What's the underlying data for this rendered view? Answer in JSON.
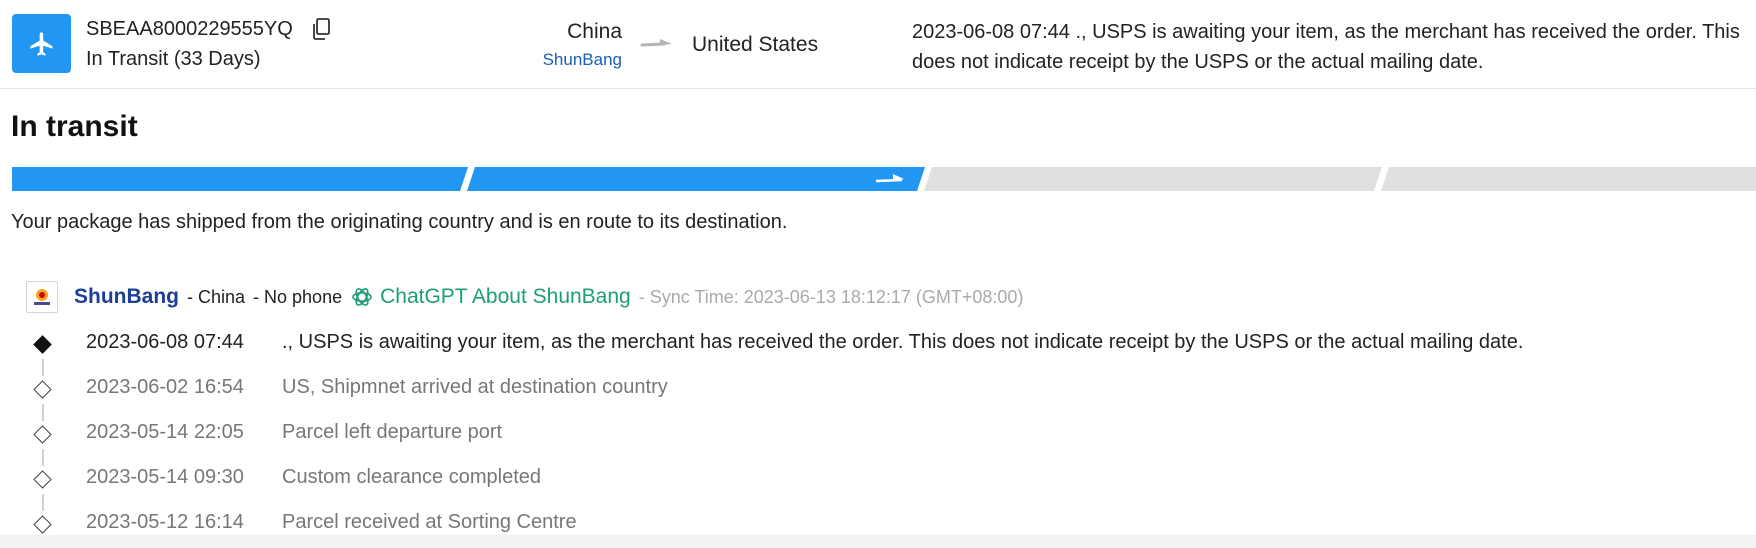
{
  "header": {
    "tracking_number": "SBEAA8000229555YQ",
    "status_days": "In Transit (33 Days)",
    "origin_country": "China",
    "carrier_link": "ShunBang",
    "destination_country": "United States",
    "latest_event": "2023-06-08 07:44  ., USPS is awaiting your item, as the merchant has received the order. This does not indicate receipt by the USPS or the actual mailing date.",
    "icons": {
      "status": "airplane-icon",
      "copy": "copy-icon",
      "route": "arrow-right-icon"
    }
  },
  "main": {
    "title": "In transit",
    "progress": {
      "steps_total": 4,
      "steps_completed": 2,
      "active_color": "#2196f3",
      "inactive_color": "#e0e0e0"
    },
    "description": "Your package has shipped from the originating country and is en route to its destination."
  },
  "carrier": {
    "name": "ShunBang",
    "country": "- China",
    "phone": "- No phone",
    "chatgpt_link": "ChatGPT About ShunBang",
    "sync_time": "- Sync Time: 2023-06-13 18:12:17 (GMT+08:00)",
    "icons": {
      "logo": "carrier-logo",
      "chatgpt": "openai-icon"
    }
  },
  "events": [
    {
      "time": "2023-06-08 07:44",
      "message": "., USPS is awaiting your item, as the merchant has received the order. This does not indicate receipt by the USPS or the actual mailing date."
    },
    {
      "time": "2023-06-02 16:54",
      "message": "US, Shipmnet arrived at destination country"
    },
    {
      "time": "2023-05-14 22:05",
      "message": "Parcel left departure port"
    },
    {
      "time": "2023-05-14 09:30",
      "message": "Custom clearance completed"
    },
    {
      "time": "2023-05-12 16:14",
      "message": "Parcel received at Sorting Centre"
    }
  ],
  "colors": {
    "accent": "#2196f3",
    "carrier_name": "#1c3f94",
    "chatgpt_green": "#1e9e78",
    "link_blue": "#1a5fb4",
    "muted": "#aaaaaa"
  }
}
